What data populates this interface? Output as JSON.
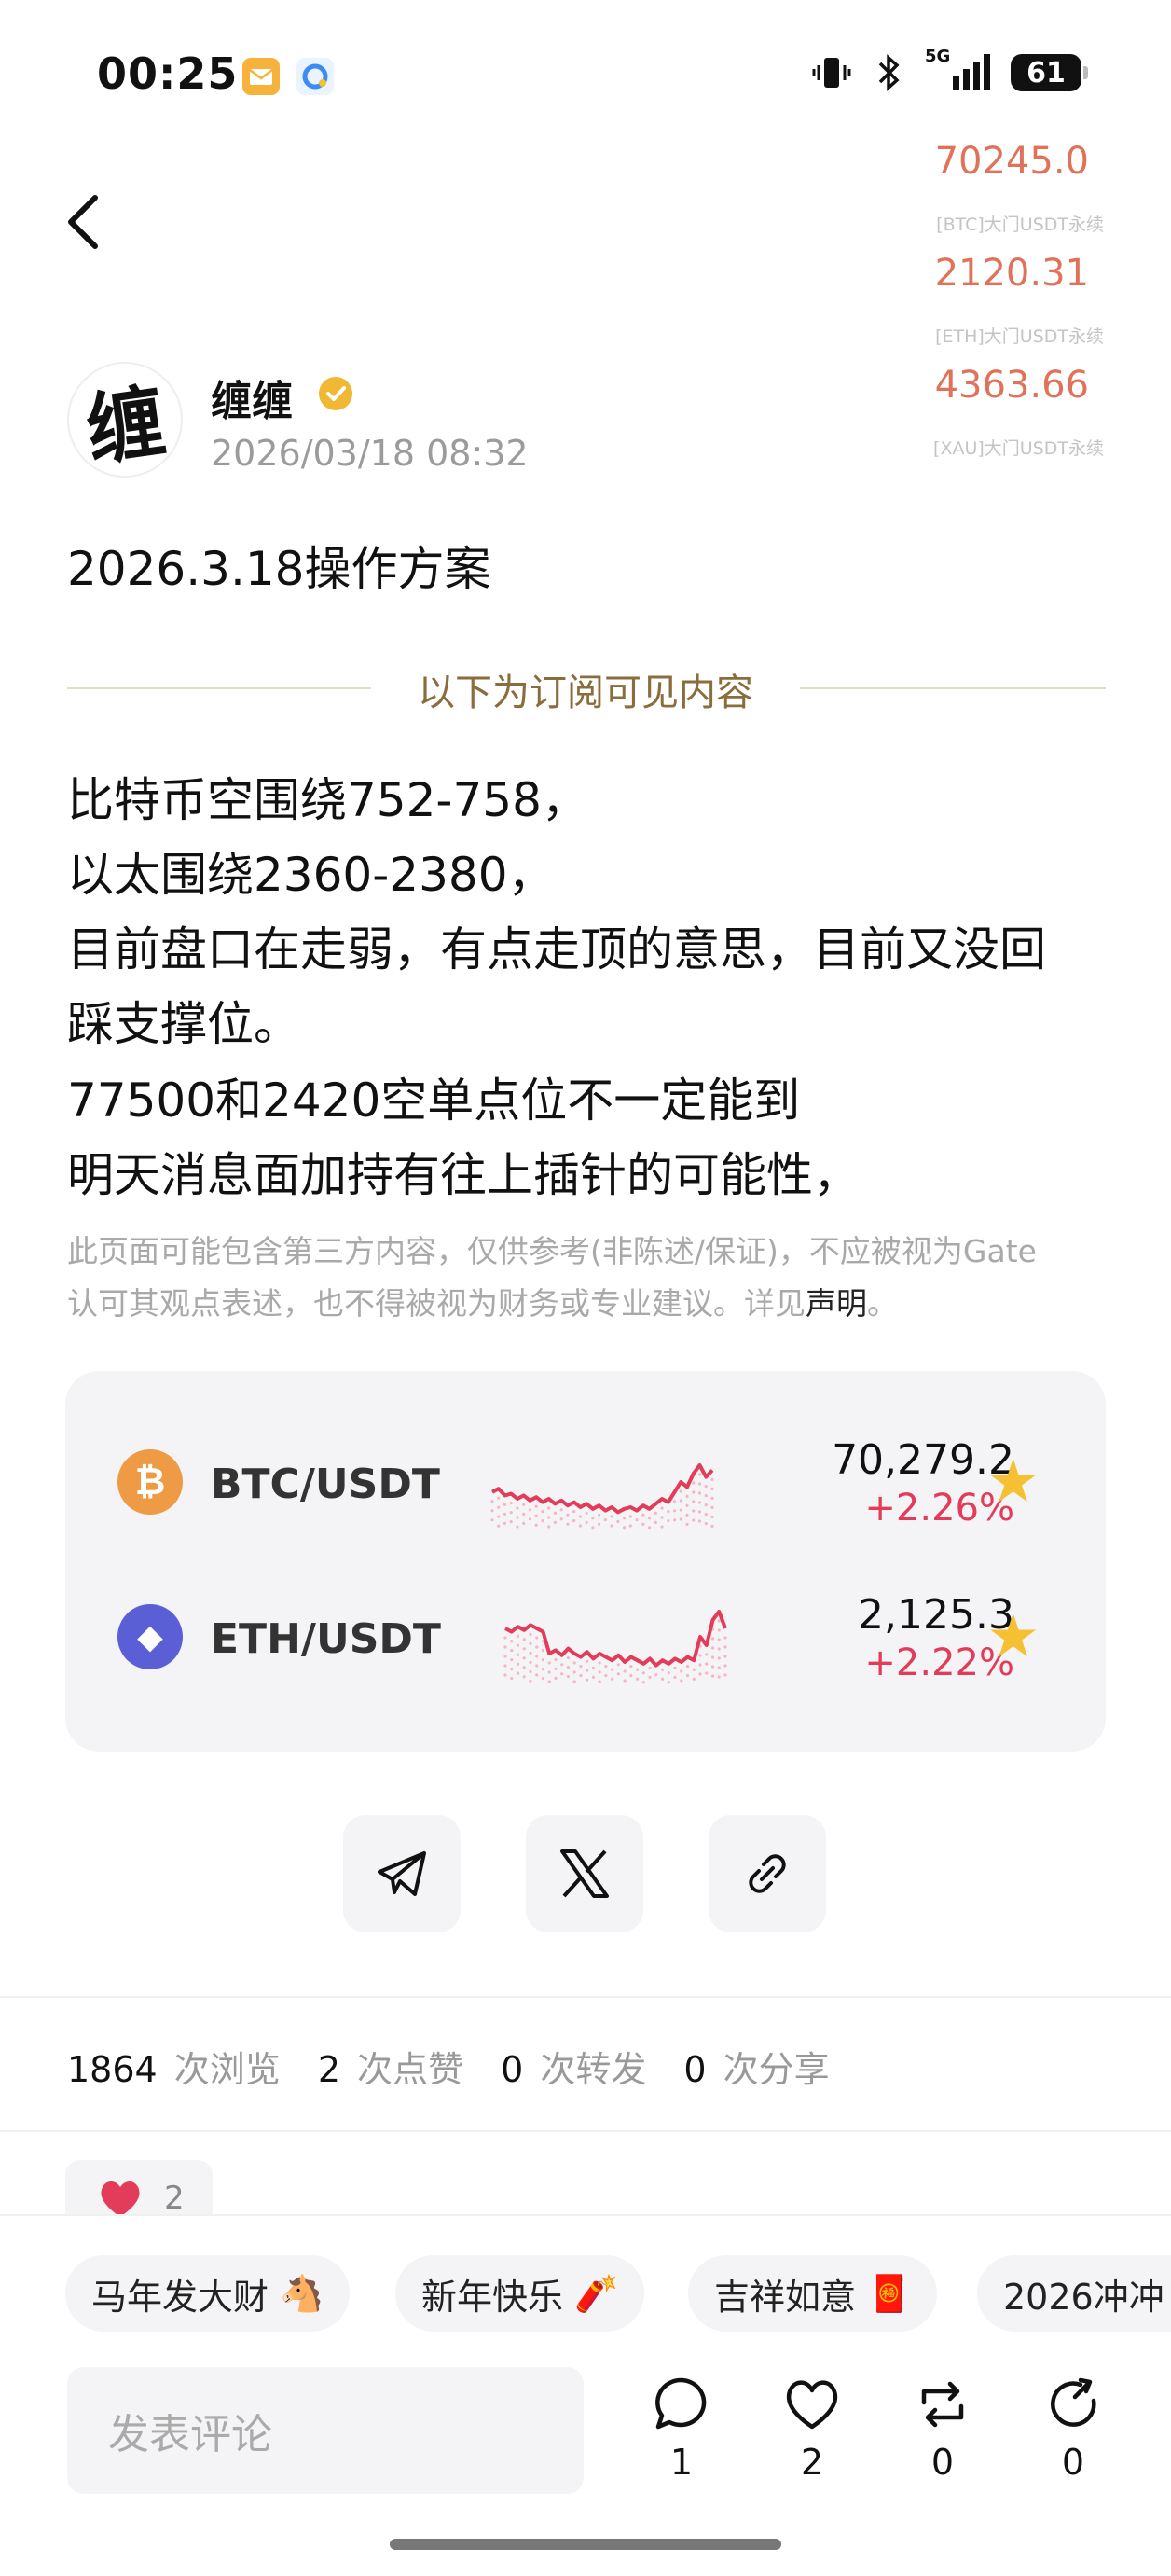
{
  "status_bar": {
    "time": "00:25",
    "signal_label": "5G",
    "battery": "61"
  },
  "tickers": [
    {
      "price": "70245.0",
      "name": "[BTC]大门USDT永续"
    },
    {
      "price": "2120.31",
      "name": "[ETH]大门USDT永续"
    },
    {
      "price": "4363.66",
      "name": "[XAU]大门USDT永续"
    }
  ],
  "author": {
    "name": "缠缠",
    "avatar_char": "缠",
    "date": "2026/03/18 08:32"
  },
  "post": {
    "title": "2026.3.18操作方案",
    "divider_text": "以下为订阅可见内容",
    "lines": [
      "比特币空围绕752-758，",
      "以太围绕2360-2380，",
      "目前盘口在走弱，有点走顶的意思，目前又没回",
      "踩支撑位。",
      "77500和2420空单点位不一定能到",
      "明天消息面加持有往上插针的可能性，"
    ],
    "disclaimer_line1": "此页面可能包含第三方内容，仅供参考(非陈述/保证)，不应被视为Gate",
    "disclaimer_line2": "认可其观点表述，也不得被视为财务或专业建议。详见",
    "disclaimer_link": "声明",
    "disclaimer_end": "。"
  },
  "market": [
    {
      "pair": "BTC/USDT",
      "symbol": "₿",
      "color": "#ef9a44",
      "price": "70,279.2",
      "change": "+2.26%",
      "spark": [
        0.62,
        0.58,
        0.66,
        0.64,
        0.7,
        0.66,
        0.72,
        0.68,
        0.74,
        0.7,
        0.76,
        0.72,
        0.78,
        0.74,
        0.8,
        0.76,
        0.82,
        0.78,
        0.84,
        0.8,
        0.86,
        0.82,
        0.8,
        0.84,
        0.78,
        0.82,
        0.76,
        0.7,
        0.74,
        0.62,
        0.5,
        0.56,
        0.4,
        0.3,
        0.44,
        0.36
      ]
    },
    {
      "pair": "ETH/USDT",
      "symbol": "◆",
      "color": "#5a5fd6",
      "price": "2,125.3",
      "change": "+2.22%",
      "spark": [
        0.4,
        0.44,
        0.38,
        0.42,
        0.36,
        0.4,
        0.44,
        0.7,
        0.66,
        0.72,
        0.64,
        0.7,
        0.74,
        0.68,
        0.76,
        0.7,
        0.74,
        0.78,
        0.72,
        0.8,
        0.74,
        0.78,
        0.82,
        0.76,
        0.84,
        0.78,
        0.82,
        0.76,
        0.8,
        0.74,
        0.78,
        0.5,
        0.6,
        0.3,
        0.2,
        0.4
      ]
    }
  ],
  "share": [
    "telegram-icon",
    "x-icon",
    "link-icon"
  ],
  "stats": {
    "views": "1864",
    "views_label": "次浏览",
    "likes": "2",
    "likes_label": "次点赞",
    "reposts": "0",
    "reposts_label": "次转发",
    "shares": "0",
    "shares_label": "次分享"
  },
  "like_chip": {
    "count": "2"
  },
  "tags": [
    {
      "label": "马年发大财",
      "emoji": "🐴"
    },
    {
      "label": "新年快乐",
      "emoji": "🧨"
    },
    {
      "label": "吉祥如意",
      "emoji": "🧧"
    },
    {
      "label": "2026冲冲",
      "emoji": ""
    }
  ],
  "comment": {
    "placeholder": "发表评论"
  },
  "actions": [
    {
      "name": "comment",
      "count": "1"
    },
    {
      "name": "like",
      "count": "2"
    },
    {
      "name": "repost",
      "count": "0"
    },
    {
      "name": "share",
      "count": "0"
    }
  ],
  "colors": {
    "accent_red": "#e33b5a",
    "ticker_orange": "#e0725a",
    "gold": "#8a6d3b",
    "star": "#f5c032"
  }
}
